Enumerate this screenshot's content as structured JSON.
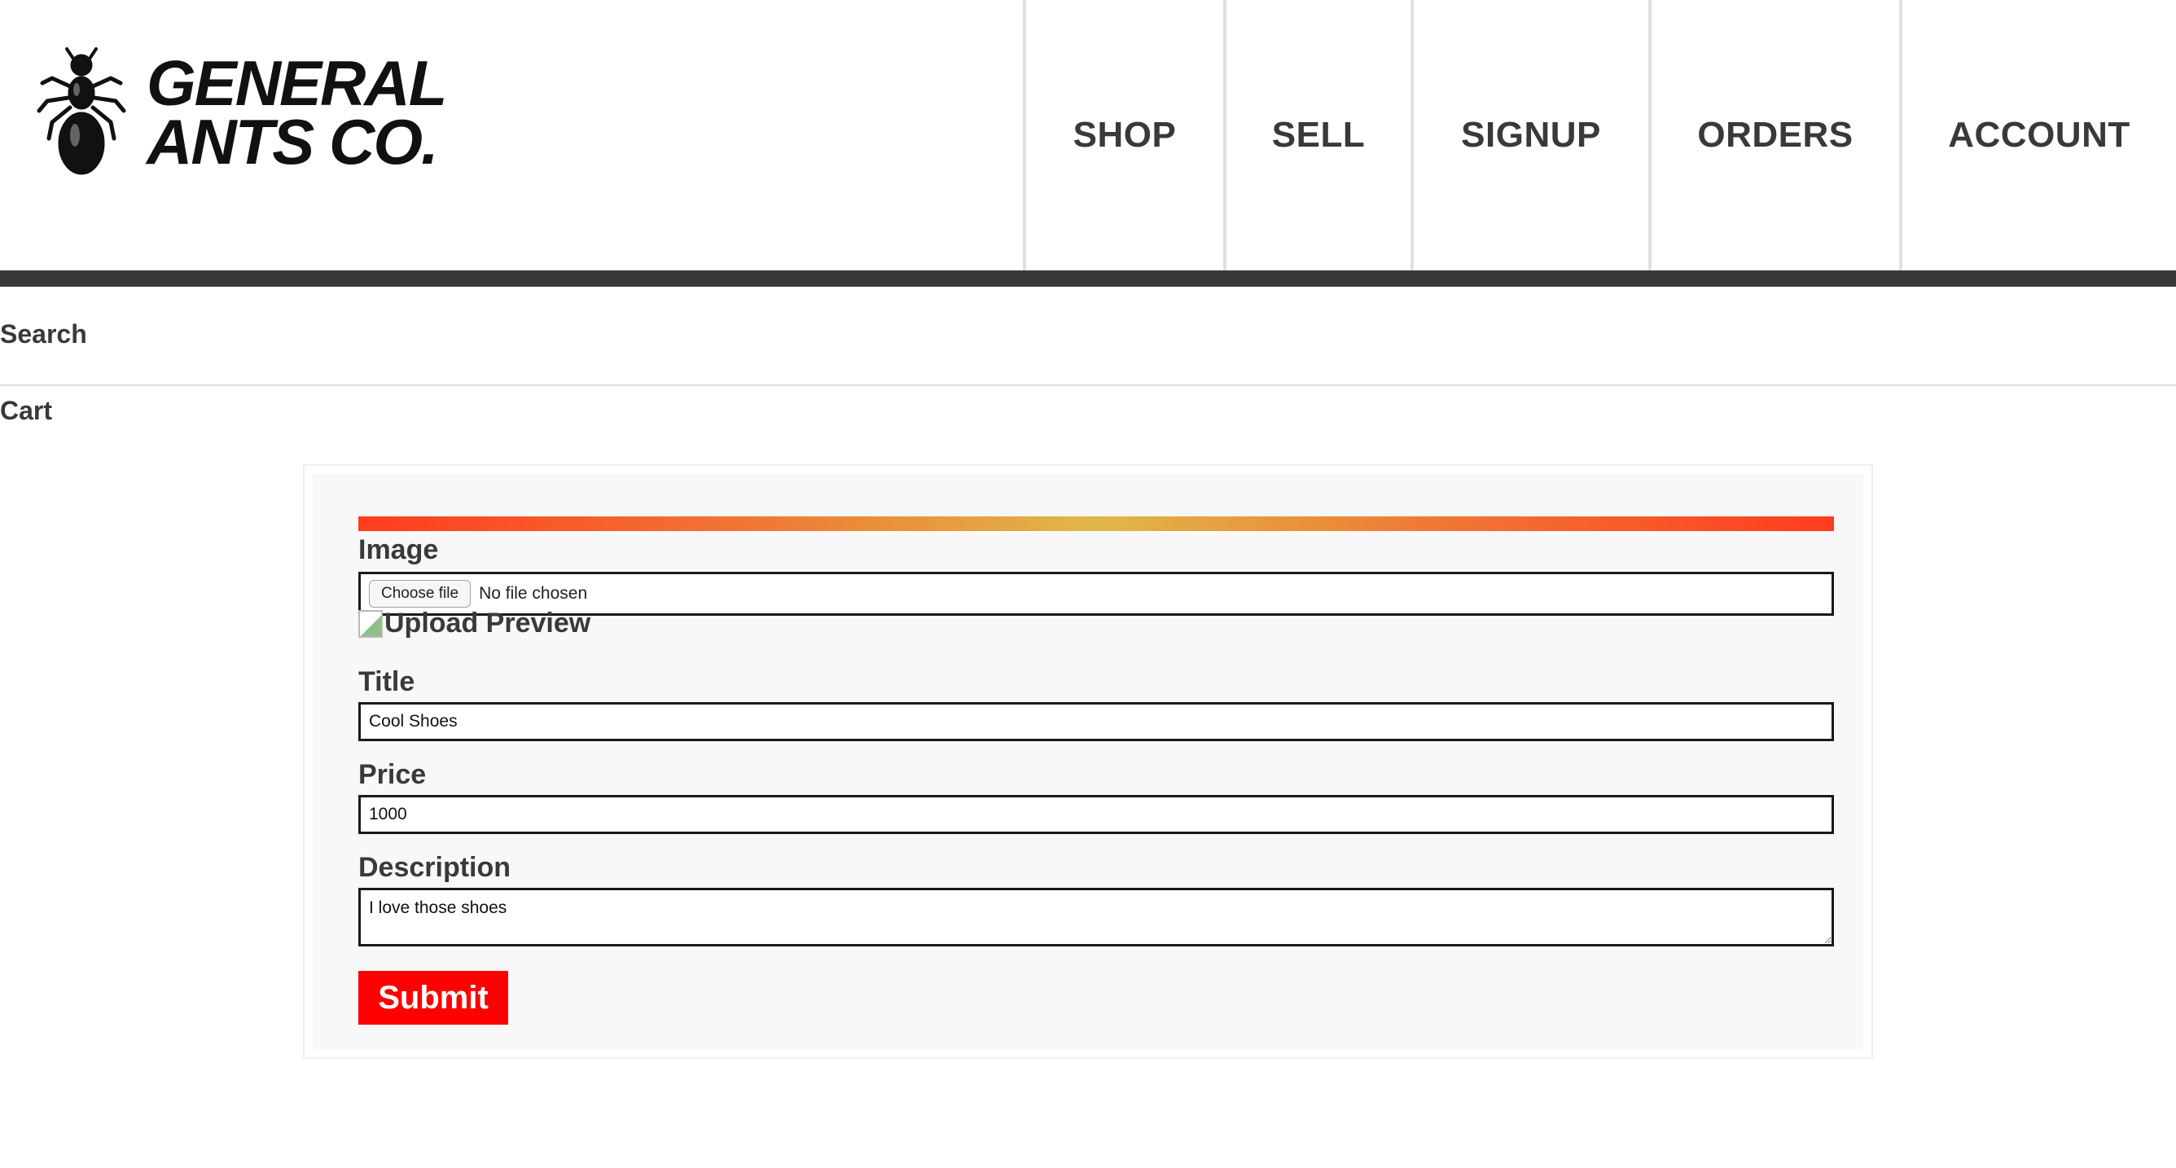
{
  "header": {
    "logo": {
      "icon": "ant-icon",
      "line1": "GENERAL",
      "line2": "ANTS CO."
    },
    "nav": [
      {
        "label": "SHOP"
      },
      {
        "label": "SELL"
      },
      {
        "label": "SIGNUP"
      },
      {
        "label": "ORDERS"
      },
      {
        "label": "ACCOUNT"
      }
    ],
    "bar_color": "#393939"
  },
  "side_links": {
    "search": "Search",
    "cart": "Cart"
  },
  "form": {
    "accent_gradient": [
      "#ff3c1f",
      "#e0b848",
      "#ff3c1f"
    ],
    "image": {
      "label": "Image",
      "button_label": "Choose file",
      "status": "No file chosen"
    },
    "preview": {
      "icon": "broken-image-icon",
      "alt_text": "Upload Preview"
    },
    "title": {
      "label": "Title",
      "value": "Cool Shoes"
    },
    "price": {
      "label": "Price",
      "value": "1000"
    },
    "description": {
      "label": "Description",
      "value": "I love those shoes"
    },
    "submit": {
      "label": "Submit",
      "color": "#ff0000"
    }
  }
}
